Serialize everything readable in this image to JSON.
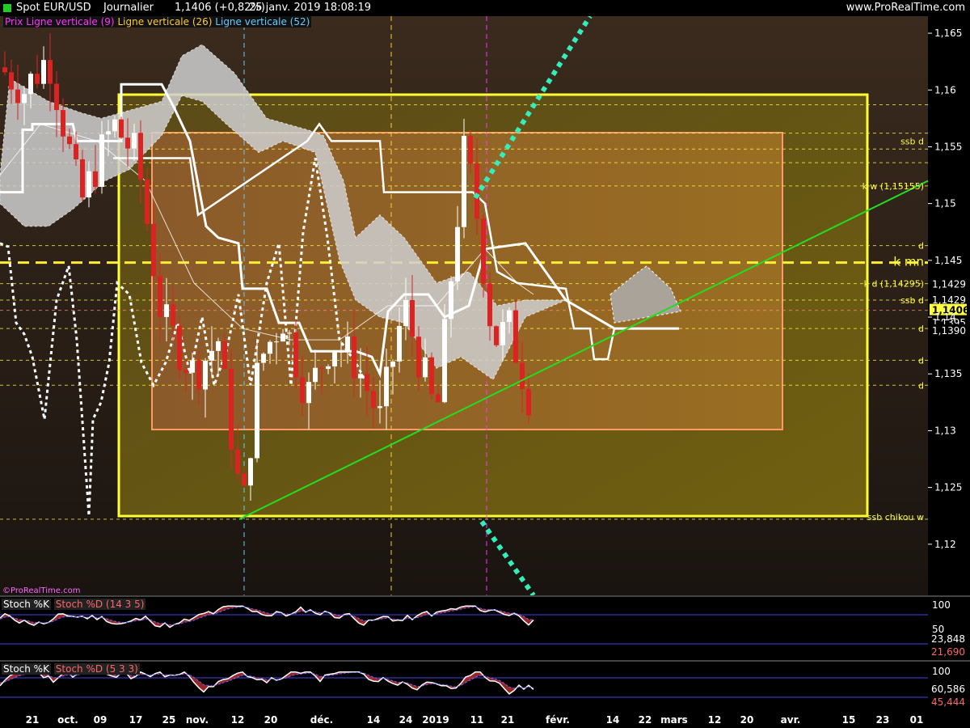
{
  "header": {
    "instrument": "Spot EUR/USD",
    "timeframe": "Journalier",
    "last_price": "1,1406 (+0,82%)",
    "datetime": "25 janv. 2019 18:08:19",
    "brand": "www.ProRealTime.com"
  },
  "legend": {
    "price": "Prix",
    "v9": "Ligne verticale (9)",
    "v26": "Ligne verticale (26)",
    "v52": "Ligne verticale (52)"
  },
  "watermark": "©ProRealTime.com",
  "colors": {
    "bg_top": "#3b2b1e",
    "bg_bottom": "#1a1410",
    "zone_yellow": "#ffff33",
    "zone_orange": "#ff9966",
    "trend_green": "#22dd22",
    "cyan_dotted": "#33eebb",
    "label_yellow": "#ffff44",
    "up_candle": "#ffffff",
    "down_candle": "#dd2222"
  },
  "chart_data": [
    {
      "type": "line",
      "title": "Spot EUR/USD",
      "y_axis": {
        "range": [
          1.1155,
          1.1665
        ],
        "ticks": [
          "1,165",
          "1,16",
          "1,155",
          "1,15",
          "1,145",
          "1,14",
          "1,135",
          "1,13",
          "1,125",
          "1,12"
        ]
      },
      "x_axis": {
        "ticks": [
          "21",
          "oct.",
          "09",
          "17",
          "25",
          "nov.",
          "12",
          "20",
          "déc.",
          "14",
          "24",
          "2019",
          "11",
          "21",
          "févr.",
          "14",
          "22",
          "mars",
          "12",
          "20",
          "avr.",
          "15",
          "23",
          "01"
        ]
      },
      "price_labels": [
        {
          "text": "ssb d",
          "value": 1.1555
        },
        {
          "text": "k w (1,15155)",
          "value": 1.15155
        },
        {
          "text": "d",
          "value": 1.1463
        },
        {
          "text": "k mn",
          "value": 1.1448
        },
        {
          "text": "k d (1,14295)",
          "value": 1.14295
        },
        {
          "text": "1,1429",
          "value": 1.1429
        },
        {
          "text": "ssb d",
          "value": 1.1415
        },
        {
          "text": "1,1429",
          "value": 1.1415
        },
        {
          "text": "1,1406",
          "value": 1.1406
        },
        {
          "text": "1,1395",
          "value": 1.1395
        },
        {
          "text": "d",
          "value": 1.139
        },
        {
          "text": "1,1390",
          "value": 1.1388
        },
        {
          "text": "d",
          "value": 1.1362
        },
        {
          "text": "d",
          "value": 1.134
        },
        {
          "text": "ssb chikou w",
          "value": 1.1224
        }
      ],
      "horizontal_levels": [
        1.1587,
        1.1562,
        1.1548,
        1.1536,
        1.15155,
        1.1463,
        1.1448,
        1.14295,
        1.1415,
        1.1406,
        1.139,
        1.1362,
        1.134,
        1.1222
      ],
      "zones": [
        {
          "name": "zone-jaune",
          "y_top": 1.1591,
          "y_bottom": 1.1224
        },
        {
          "name": "zone-orange",
          "y_top": 1.1556,
          "y_bottom": 1.1297
        }
      ]
    },
    {
      "type": "line",
      "title": "Stoch %K Stoch %D (14 3 5)",
      "series": [
        {
          "name": "Stoch %K"
        },
        {
          "name": "Stoch %D (14 3 5)"
        }
      ],
      "y_axis": {
        "ticks": [
          "100",
          "50"
        ]
      },
      "last_values": {
        "k": "23,848",
        "d": "21,690"
      }
    },
    {
      "type": "line",
      "title": "Stoch %K Stoch %D (5 3 3)",
      "series": [
        {
          "name": "Stoch %K"
        },
        {
          "name": "Stoch %D (5 3 3)"
        }
      ],
      "y_axis": {
        "ticks": [
          "100"
        ]
      },
      "last_values": {
        "k": "60,586",
        "d": "45,444"
      }
    }
  ]
}
